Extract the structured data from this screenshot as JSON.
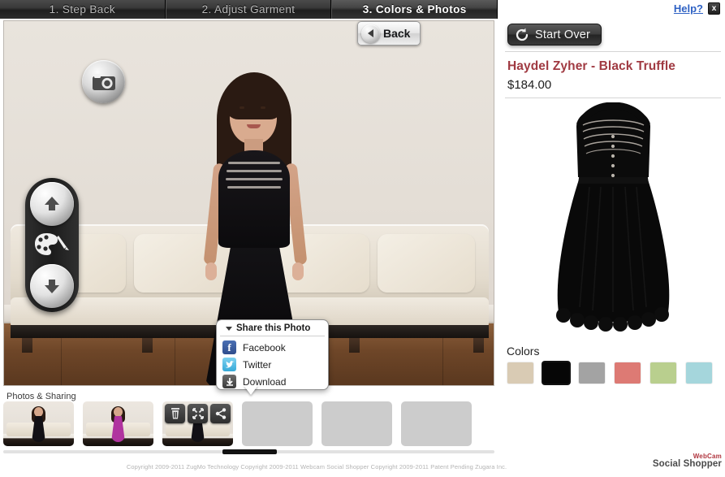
{
  "tabs": [
    {
      "label": "1. Step Back",
      "active": false
    },
    {
      "label": "2. Adjust Garment",
      "active": false
    },
    {
      "label": "3. Colors & Photos",
      "active": true
    }
  ],
  "stage": {
    "back_button_label": "Back",
    "camera_icon": "camera-icon",
    "pod": {
      "up_icon": "arrow-up-icon",
      "palette_icon": "palette-icon",
      "down_icon": "arrow-down-icon"
    }
  },
  "share_popup": {
    "title": "Share this Photo",
    "items": [
      {
        "label": "Facebook",
        "icon": "facebook-icon"
      },
      {
        "label": "Twitter",
        "icon": "twitter-icon"
      },
      {
        "label": "Download",
        "icon": "download-icon"
      }
    ]
  },
  "photos": {
    "section_label": "Photos & Sharing",
    "thumbnails": [
      {
        "kind": "photo",
        "dress_color": "#121015",
        "selected": false
      },
      {
        "kind": "photo",
        "dress_color": "#b0339f",
        "selected": false
      },
      {
        "kind": "photo",
        "dress_color": "#121015",
        "selected": true
      },
      {
        "kind": "empty"
      },
      {
        "kind": "empty"
      },
      {
        "kind": "empty"
      }
    ],
    "overlay_actions": [
      {
        "name": "delete-icon",
        "label": "Delete"
      },
      {
        "name": "expand-icon",
        "label": "Expand"
      },
      {
        "name": "share-icon",
        "label": "Share"
      }
    ]
  },
  "right_panel": {
    "help_label": "Help?",
    "close_label": "x",
    "start_over_label": "Start Over",
    "start_over_icon": "refresh-icon",
    "product_name": "Haydel Zyher - Black Truffle",
    "product_price": "$184.00",
    "product_image_alt": "black-dress-image",
    "colors_label": "Colors",
    "swatches": [
      {
        "name": "beige",
        "hex": "#d9cbb4",
        "selected": false
      },
      {
        "name": "black",
        "hex": "#060606",
        "selected": true
      },
      {
        "name": "gray",
        "hex": "#a3a3a3",
        "selected": false
      },
      {
        "name": "coral",
        "hex": "#dd7a74",
        "selected": false
      },
      {
        "name": "sage",
        "hex": "#b9cf8e",
        "selected": false
      },
      {
        "name": "aqua",
        "hex": "#a5d6dc",
        "selected": false
      }
    ]
  },
  "footer": {
    "copyright": "Copyright 2009-2011 ZugMo Technology Copyright 2009-2011 Webcam Social Shopper Copyright 2009-2011 Patent Pending Zugara Inc.",
    "logo_top": "WebCam",
    "logo_bottom": "Social Shopper"
  },
  "colors": {
    "brand_red": "#a03a42",
    "link_blue": "#2f62c4",
    "tab_active_text": "#ffffff",
    "tab_text": "#b9b9b9"
  }
}
